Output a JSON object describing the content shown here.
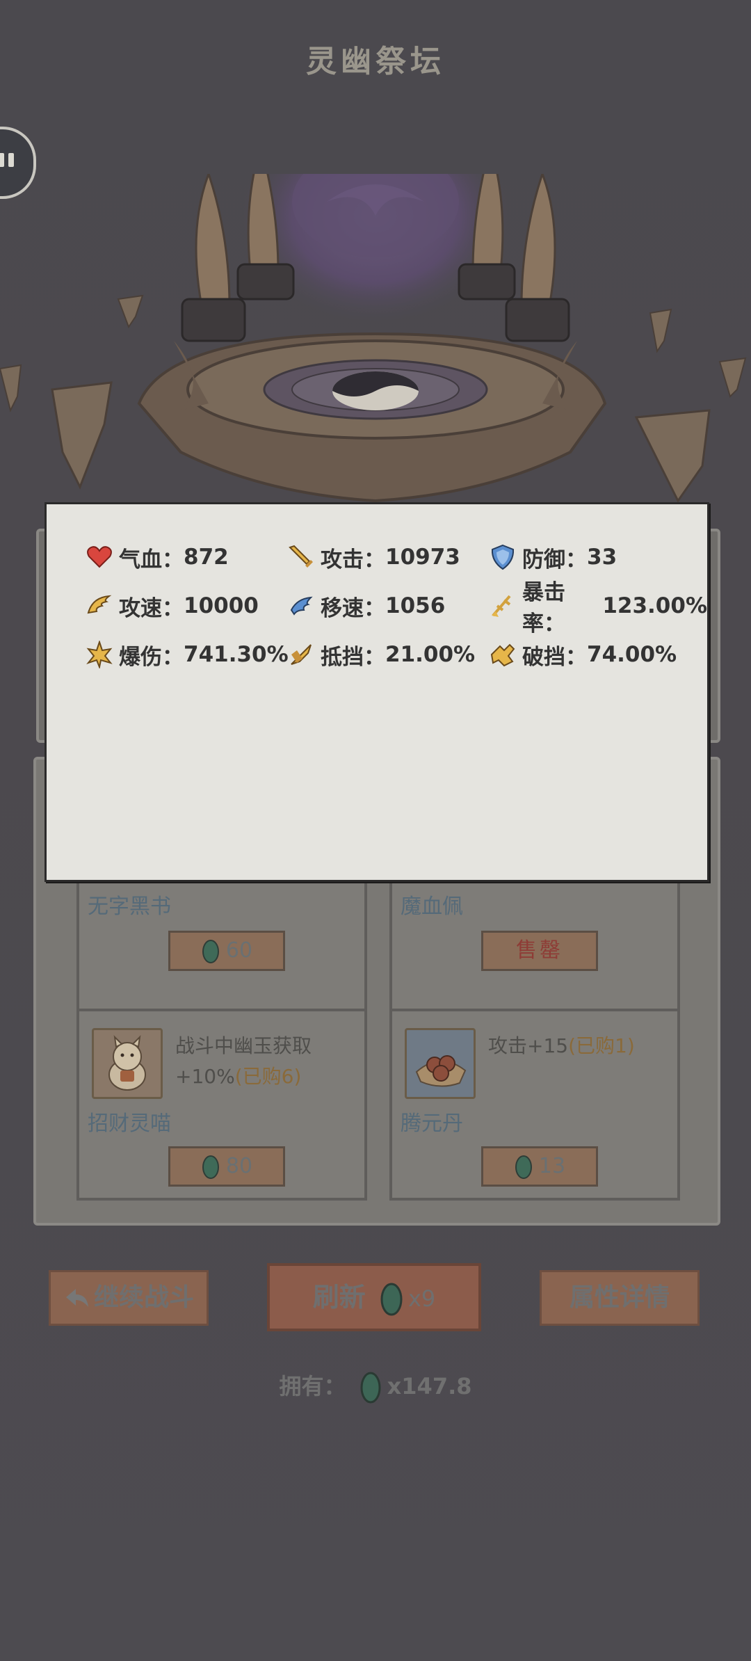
{
  "title": "灵幽祭坛",
  "stats": [
    {
      "label": "气血：",
      "value": "872",
      "icon": "heart-icon"
    },
    {
      "label": "攻击：",
      "value": "10973",
      "icon": "sword-icon"
    },
    {
      "label": "防御：",
      "value": "33",
      "icon": "shield-icon"
    },
    {
      "label": "攻速：",
      "value": "10000",
      "icon": "wing-icon"
    },
    {
      "label": "移速：",
      "value": "1056",
      "icon": "boot-icon"
    },
    {
      "label": "暴击率：",
      "value": "123.00%",
      "icon": "crit-icon"
    },
    {
      "label": "爆伤：",
      "value": "741.30%",
      "icon": "explosion-icon"
    },
    {
      "label": "抵挡：",
      "value": "21.00%",
      "icon": "block-icon"
    },
    {
      "label": "破挡：",
      "value": "74.00%",
      "icon": "break-icon"
    }
  ],
  "shop": {
    "items": [
      {
        "name": "无字黑书",
        "desc": "",
        "bought": "",
        "price": "60",
        "sold": false
      },
      {
        "name": "魔血佩",
        "desc": "",
        "bought": "",
        "price": "售罄",
        "sold": true
      },
      {
        "name": "招财灵喵",
        "desc": "战斗中幽玉获取+10%",
        "bought": "(已购6)",
        "price": "80",
        "sold": false,
        "icon": "lucky-cat-icon"
      },
      {
        "name": "腾元丹",
        "desc": "攻击+15",
        "bought": "(已购1)",
        "price": "13",
        "sold": false,
        "icon": "pill-icon"
      }
    ]
  },
  "buttons": {
    "continue": "继续战斗",
    "refresh": "刷新",
    "refresh_cost": "x9",
    "details": "属性详情"
  },
  "owned": {
    "label": "拥有：",
    "value": "x147.8"
  },
  "colors": {
    "gem": "#3d8a66",
    "popup_bg": "#e5e4df",
    "button": "#8a6450"
  }
}
